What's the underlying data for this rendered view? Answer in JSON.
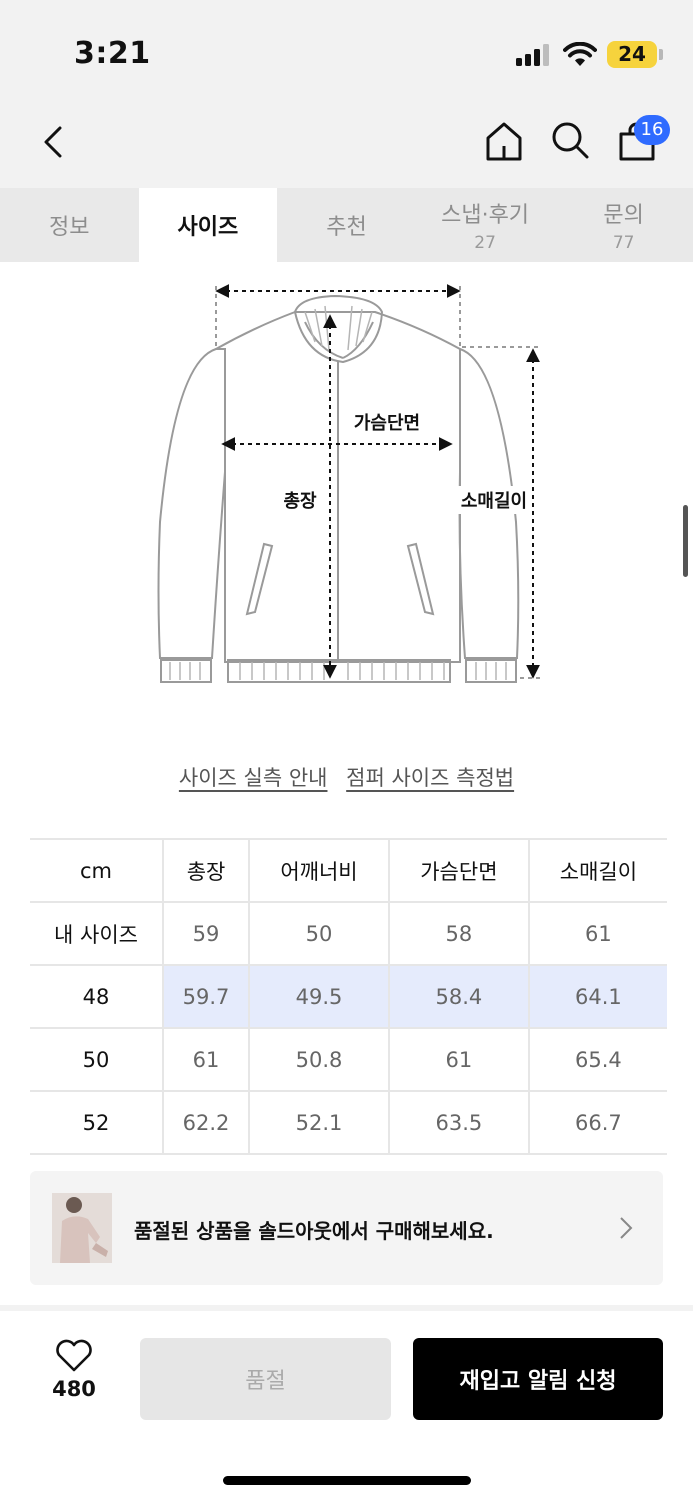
{
  "status": {
    "time": "3:21",
    "battery": "24"
  },
  "nav": {
    "cart_count": "16"
  },
  "tabs": [
    {
      "label": "정보",
      "count": ""
    },
    {
      "label": "사이즈",
      "count": ""
    },
    {
      "label": "추천",
      "count": ""
    },
    {
      "label": "스냅·후기",
      "count": "27"
    },
    {
      "label": "문의",
      "count": "77"
    }
  ],
  "diagram": {
    "chest_label": "가슴단면",
    "length_label": "총장",
    "sleeve_label": "소매길이"
  },
  "links": {
    "guide": "사이즈 실측 안내",
    "method": "점퍼 사이즈 측정법"
  },
  "size_table": {
    "headers": [
      "cm",
      "총장",
      "어깨너비",
      "가슴단면",
      "소매길이"
    ],
    "rows": [
      [
        "내 사이즈",
        "59",
        "50",
        "58",
        "61"
      ],
      [
        "48",
        "59.7",
        "49.5",
        "58.4",
        "64.1"
      ],
      [
        "50",
        "61",
        "50.8",
        "61",
        "65.4"
      ],
      [
        "52",
        "62.2",
        "52.1",
        "63.5",
        "66.7"
      ]
    ]
  },
  "banner": {
    "text": "품절된 상품을 솔드아웃에서 구매해보세요."
  },
  "bottom": {
    "likes": "480",
    "soldout_label": "품절",
    "restock_label": "재입고 알림 신청"
  },
  "colors": {
    "accent_badge": "#2f6bff",
    "highlight_row": "#e5ebfc",
    "battery": "#f6d33d"
  }
}
